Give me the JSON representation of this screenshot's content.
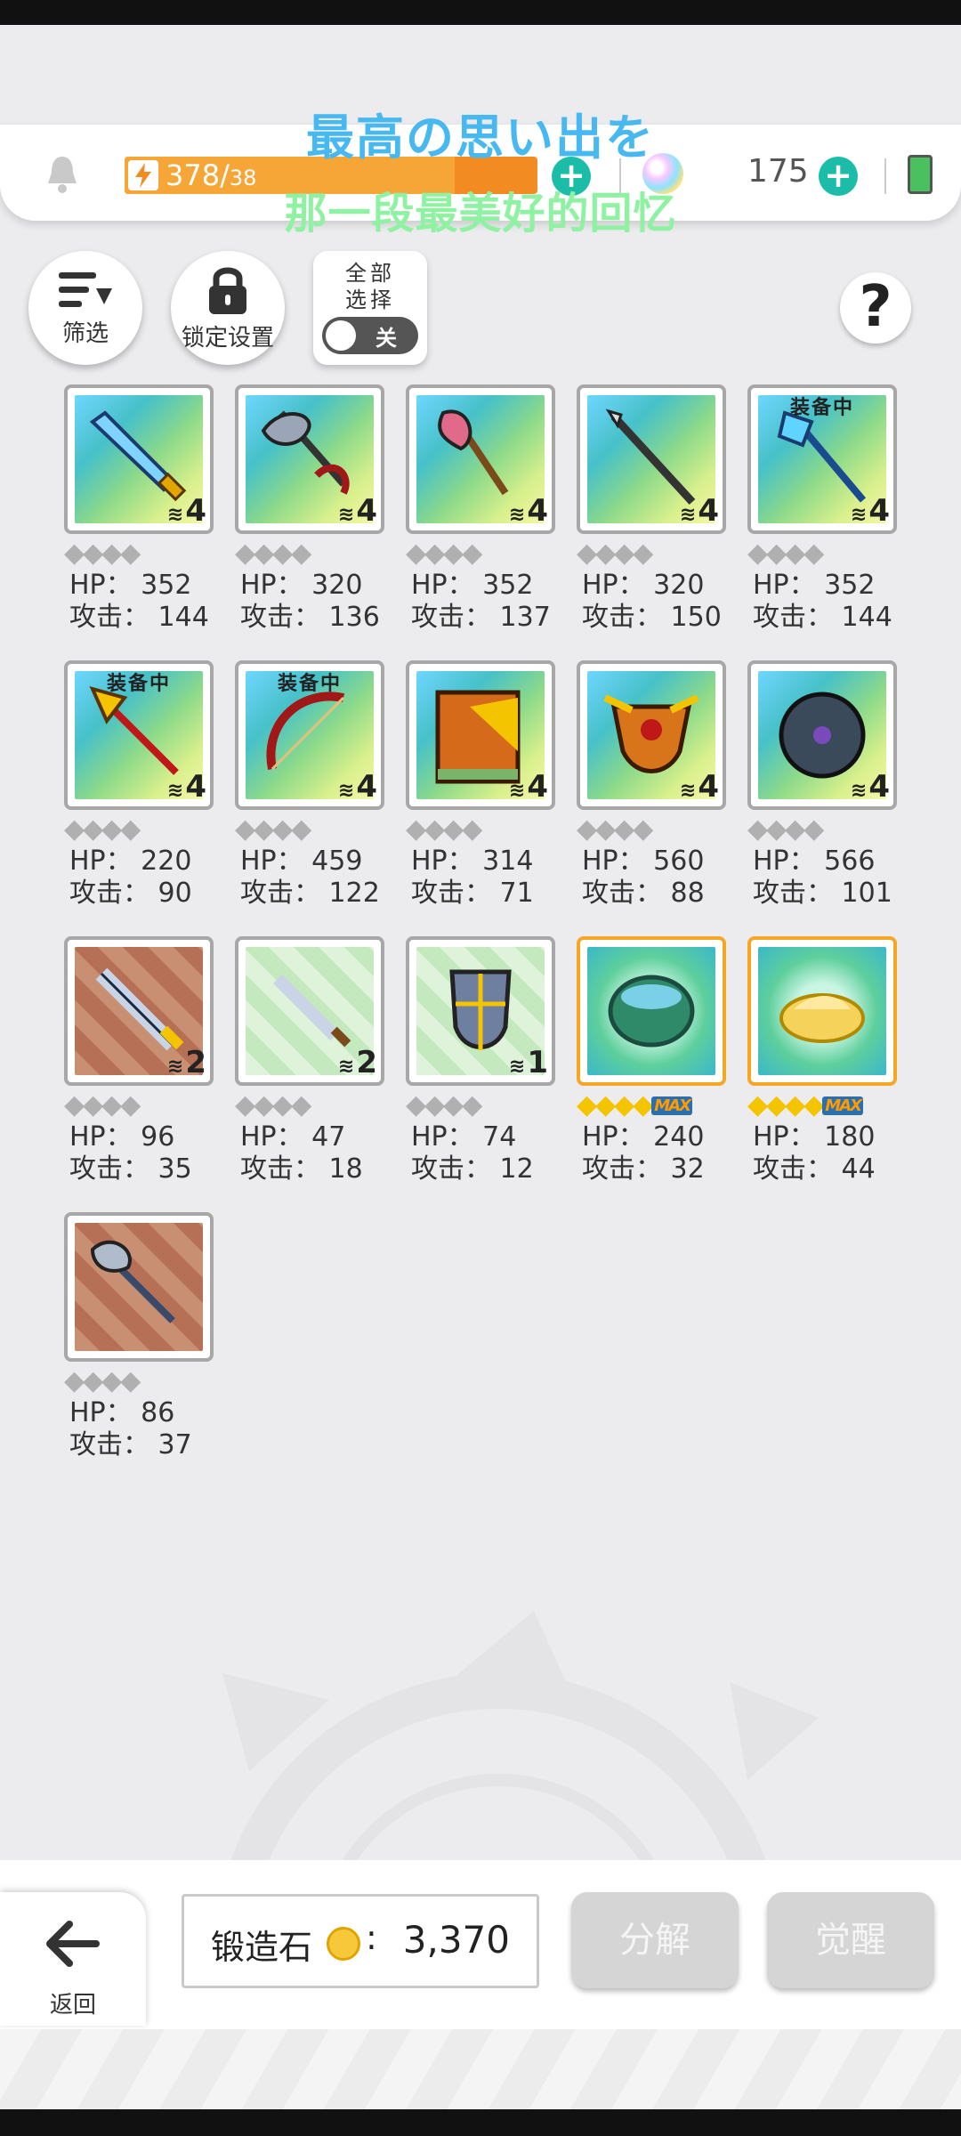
{
  "header": {
    "energy_current": "378",
    "energy_sep": "/",
    "energy_max": "38",
    "energy_fraction": 0.8,
    "gem_count": "175",
    "overlay_line1": "最高の思い出を",
    "overlay_line2": "那一段最美好的回忆"
  },
  "toolbar": {
    "filter_label": "筛选",
    "lock_label": "锁定设置",
    "select_all_line1": "全部",
    "select_all_line2": "选择",
    "toggle_label": "关"
  },
  "items": [
    {
      "equipped": "",
      "count": "4",
      "hp": "HP： 352",
      "atk": "攻击： 144"
    },
    {
      "equipped": "",
      "count": "4",
      "hp": "HP： 320",
      "atk": "攻击： 136"
    },
    {
      "equipped": "",
      "count": "4",
      "hp": "HP： 352",
      "atk": "攻击： 137"
    },
    {
      "equipped": "",
      "count": "4",
      "hp": "HP： 320",
      "atk": "攻击： 150"
    },
    {
      "equipped": "装备中",
      "count": "4",
      "hp": "HP： 352",
      "atk": "攻击： 144"
    },
    {
      "equipped": "装备中",
      "count": "4",
      "hp": "HP： 220",
      "atk": "攻击： 90"
    },
    {
      "equipped": "装备中",
      "count": "4",
      "hp": "HP： 459",
      "atk": "攻击： 122"
    },
    {
      "equipped": "",
      "count": "4",
      "hp": "HP： 314",
      "atk": "攻击： 71"
    },
    {
      "equipped": "",
      "count": "4",
      "hp": "HP： 560",
      "atk": "攻击： 88"
    },
    {
      "equipped": "",
      "count": "4",
      "hp": "HP： 566",
      "atk": "攻击： 101"
    },
    {
      "equipped": "",
      "count": "2",
      "hp": "HP： 96",
      "atk": "攻击： 35"
    },
    {
      "equipped": "",
      "count": "2",
      "hp": "HP： 47",
      "atk": "攻击： 18"
    },
    {
      "equipped": "",
      "count": "1",
      "hp": "HP： 74",
      "atk": "攻击： 12"
    },
    {
      "equipped": "",
      "count": "",
      "hp": "HP： 240",
      "atk": "攻击： 32",
      "max": "MAX"
    },
    {
      "equipped": "",
      "count": "",
      "hp": "HP： 180",
      "atk": "攻击： 44",
      "max": "MAX"
    },
    {
      "equipped": "",
      "count": "",
      "hp": "HP： 86",
      "atk": "攻击： 37"
    }
  ],
  "footer": {
    "back_label": "返回",
    "forge_label": "锻造石",
    "forge_colon": ":",
    "forge_value": "3,370",
    "decompose_label": "分解",
    "awaken_label": "觉醒"
  },
  "colors": {
    "accent": "#1cbda8",
    "energy": "#f28c22",
    "overlay1": "#47b8f0",
    "overlay2": "#8ff2a2"
  }
}
